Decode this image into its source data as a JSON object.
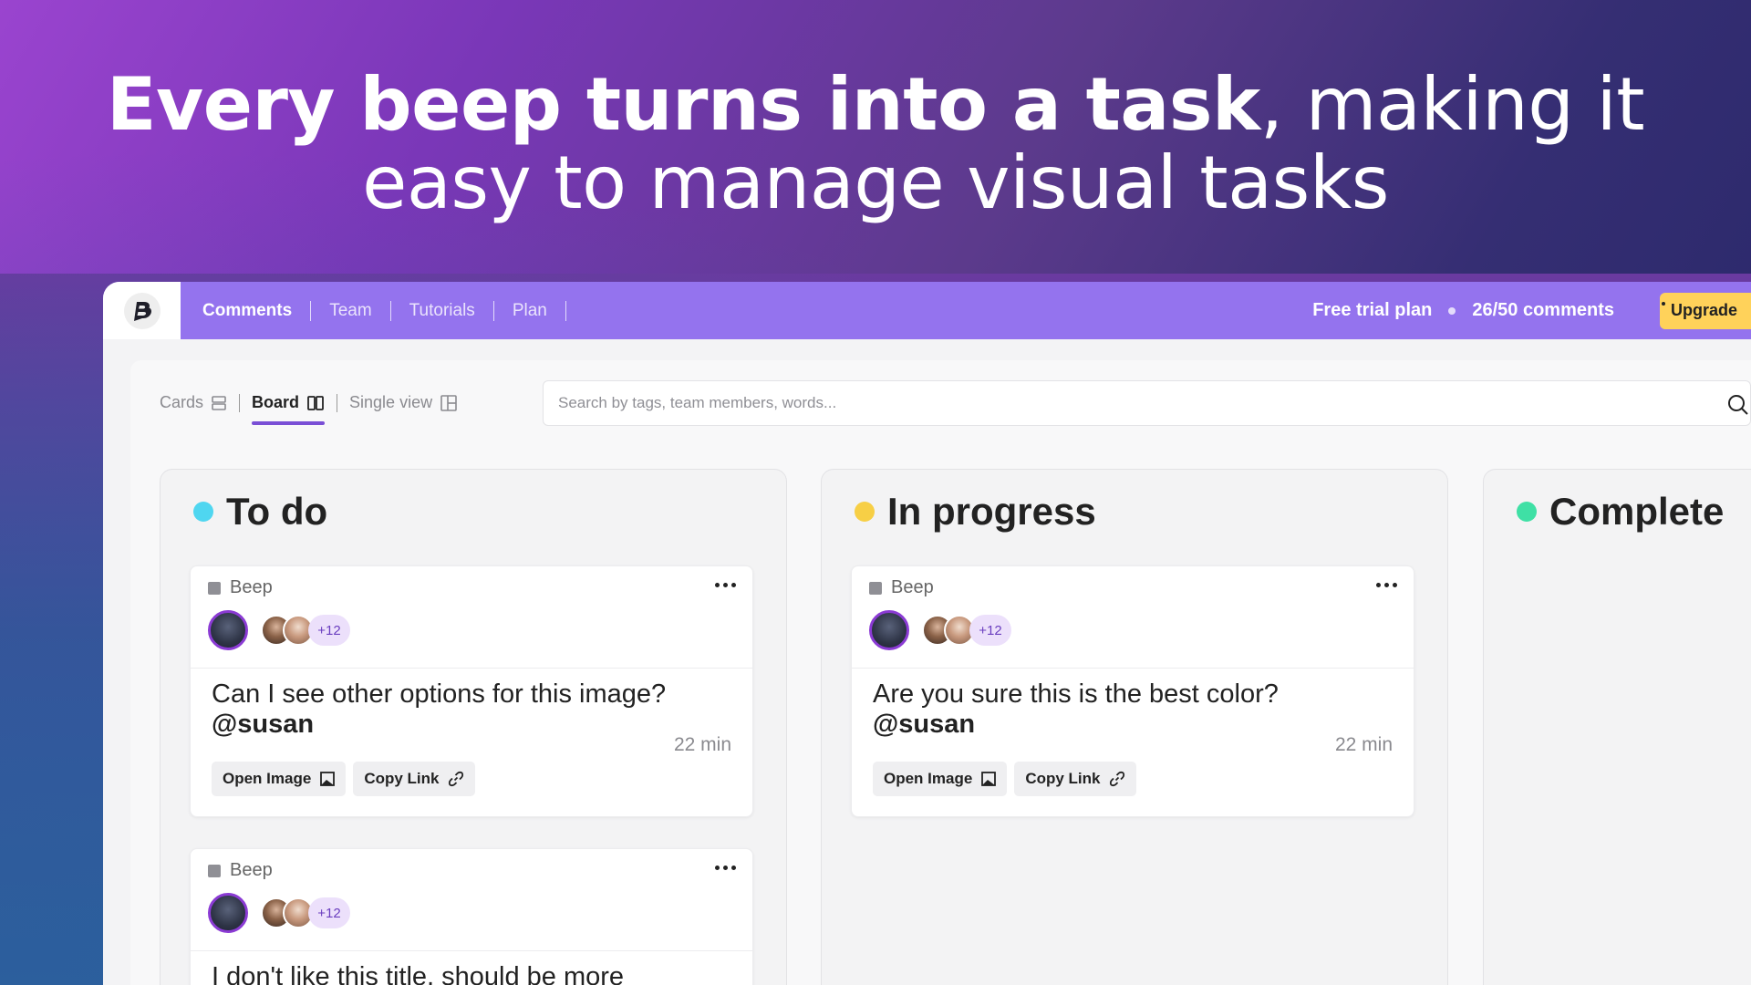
{
  "headline": {
    "bold": "Every beep turns into a task",
    "light": ", making it",
    "line2": "easy to manage visual tasks"
  },
  "topbar": {
    "nav": [
      "Comments",
      "Team",
      "Tutorials",
      "Plan"
    ],
    "plan": "Free trial plan",
    "comments_count": "26/50 comments",
    "upgrade": "Upgrade"
  },
  "views": {
    "cards": "Cards",
    "board": "Board",
    "single": "Single view",
    "active": "Board"
  },
  "search": {
    "placeholder": "Search by tags, team members, words...",
    "value": ""
  },
  "columns": [
    {
      "name": "To do",
      "color": "#4fd6f0",
      "cards": [
        {
          "tag": "Beep",
          "extra_members": "+12",
          "text": "Can I see other options for this image?",
          "mention": "@susan",
          "time": "22 min",
          "open_label": "Open Image",
          "copy_label": "Copy Link"
        },
        {
          "tag": "Beep",
          "extra_members": "+12",
          "text": "I don't like this title, should be more",
          "mention": "",
          "time": "",
          "open_label": "",
          "copy_label": ""
        }
      ]
    },
    {
      "name": "In progress",
      "color": "#f7cf45",
      "cards": [
        {
          "tag": "Beep",
          "extra_members": "+12",
          "text": "Are you sure this is the best color?",
          "mention": "@susan",
          "time": "22 min",
          "open_label": "Open Image",
          "copy_label": "Copy Link"
        }
      ]
    },
    {
      "name": "Complete",
      "color": "#3fe0a5",
      "cards": []
    }
  ]
}
